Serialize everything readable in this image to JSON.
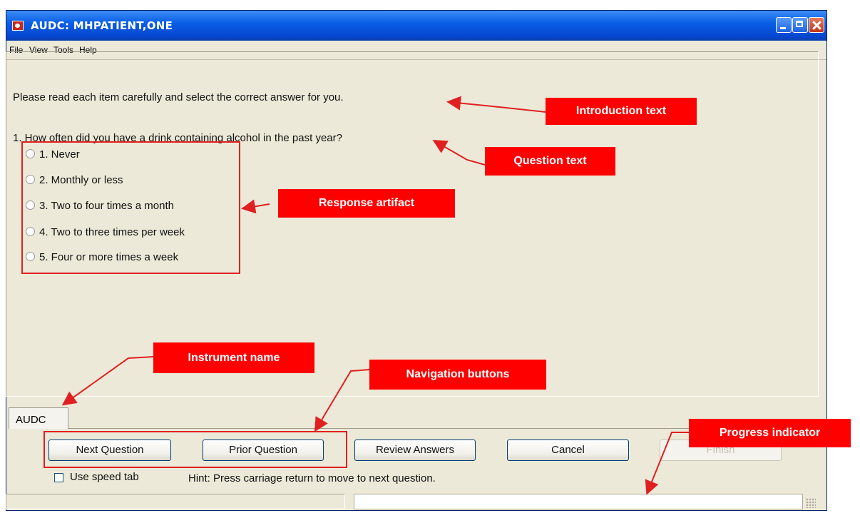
{
  "window": {
    "title": "AUDC: MHPATIENT,ONE",
    "menu": [
      "File",
      "View",
      "Tools",
      "Help"
    ]
  },
  "content": {
    "intro": "Please read each item carefully and select the correct answer for you.",
    "question": "1. How often did you have a drink containing alcohol in the past year?",
    "options": [
      "1. Never",
      "2. Monthly or less",
      "3. Two to four times a month",
      "4. Two to three times per week",
      "5. Four or more times a week"
    ]
  },
  "tab": {
    "label": "AUDC"
  },
  "buttons": {
    "next": "Next Question",
    "prior": "Prior Question",
    "review": "Review Answers",
    "cancel": "Cancel",
    "finish": "Finish"
  },
  "footer": {
    "speed_tab": "Use speed tab",
    "hint": "Hint: Press carriage return to move to next question."
  },
  "annotations": {
    "introduction": "Introduction text",
    "question": "Question text",
    "response": "Response artifact",
    "instrument": "Instrument name",
    "navigation": "Navigation buttons",
    "progress": "Progress indicator"
  },
  "colors": {
    "annotation": "#ff0000",
    "titlebar": "#0a5fe6"
  }
}
